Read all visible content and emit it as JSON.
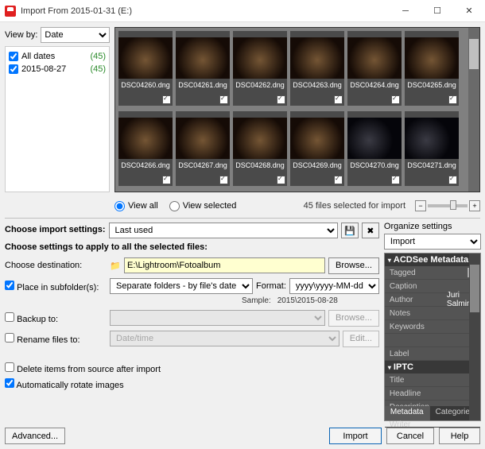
{
  "window": {
    "title": "Import From 2015-01-31 (E:)"
  },
  "sidebar": {
    "viewby_label": "View by:",
    "viewby_value": "Date",
    "dates": [
      {
        "label": "All dates",
        "count": "(45)"
      },
      {
        "label": "2015-08-27",
        "count": "(45)"
      }
    ]
  },
  "thumbnails": [
    "DSC04260.dng",
    "DSC04261.dng",
    "DSC04262.dng",
    "DSC04263.dng",
    "DSC04264.dng",
    "DSC04265.dng",
    "DSC04266.dng",
    "DSC04267.dng",
    "DSC04268.dng",
    "DSC04269.dng",
    "DSC04270.dng",
    "DSC04271.dng"
  ],
  "midbar": {
    "view_all": "View all",
    "view_selected": "View selected",
    "status": "45 files selected for import"
  },
  "settings": {
    "choose_label": "Choose import settings:",
    "choose_value": "Last used",
    "heading": "Choose settings to apply to all the selected files:",
    "dest_label": "Choose destination:",
    "dest_value": "E:\\Lightroom\\Fotoalbum",
    "browse": "Browse...",
    "subfolders_label": "Place in subfolder(s):",
    "subfolders_value": "Separate folders - by file's date",
    "format_label": "Format:",
    "format_value": "yyyy\\yyyy-MM-dd",
    "sample_label": "Sample:",
    "sample_value": "2015\\2015-08-28",
    "backup_label": "Backup to:",
    "rename_label": "Rename files to:",
    "rename_value": "Date/time",
    "edit": "Edit...",
    "delete_label": "Delete items from source after import",
    "rotate_label": "Automatically rotate images"
  },
  "organize": {
    "label": "Organize settings",
    "value": "Import",
    "section1": "ACDSee Metadata",
    "section2": "IPTC",
    "rows1": [
      {
        "k": "Tagged",
        "v": "",
        "chk": true
      },
      {
        "k": "Caption",
        "v": ""
      },
      {
        "k": "Author",
        "v": "Juri Salminen"
      },
      {
        "k": "Notes",
        "v": ""
      },
      {
        "k": "Keywords",
        "v": ""
      },
      {
        "k": "",
        "v": ""
      },
      {
        "k": "Label",
        "v": ""
      }
    ],
    "rows2": [
      {
        "k": "Title",
        "v": ""
      },
      {
        "k": "Headline",
        "v": ""
      },
      {
        "k": "Description",
        "v": ""
      },
      {
        "k": "Description Writer",
        "v": ""
      }
    ],
    "tabs": [
      "Metadata",
      "Categories"
    ]
  },
  "buttons": {
    "advanced": "Advanced...",
    "import": "Import",
    "cancel": "Cancel",
    "help": "Help"
  }
}
